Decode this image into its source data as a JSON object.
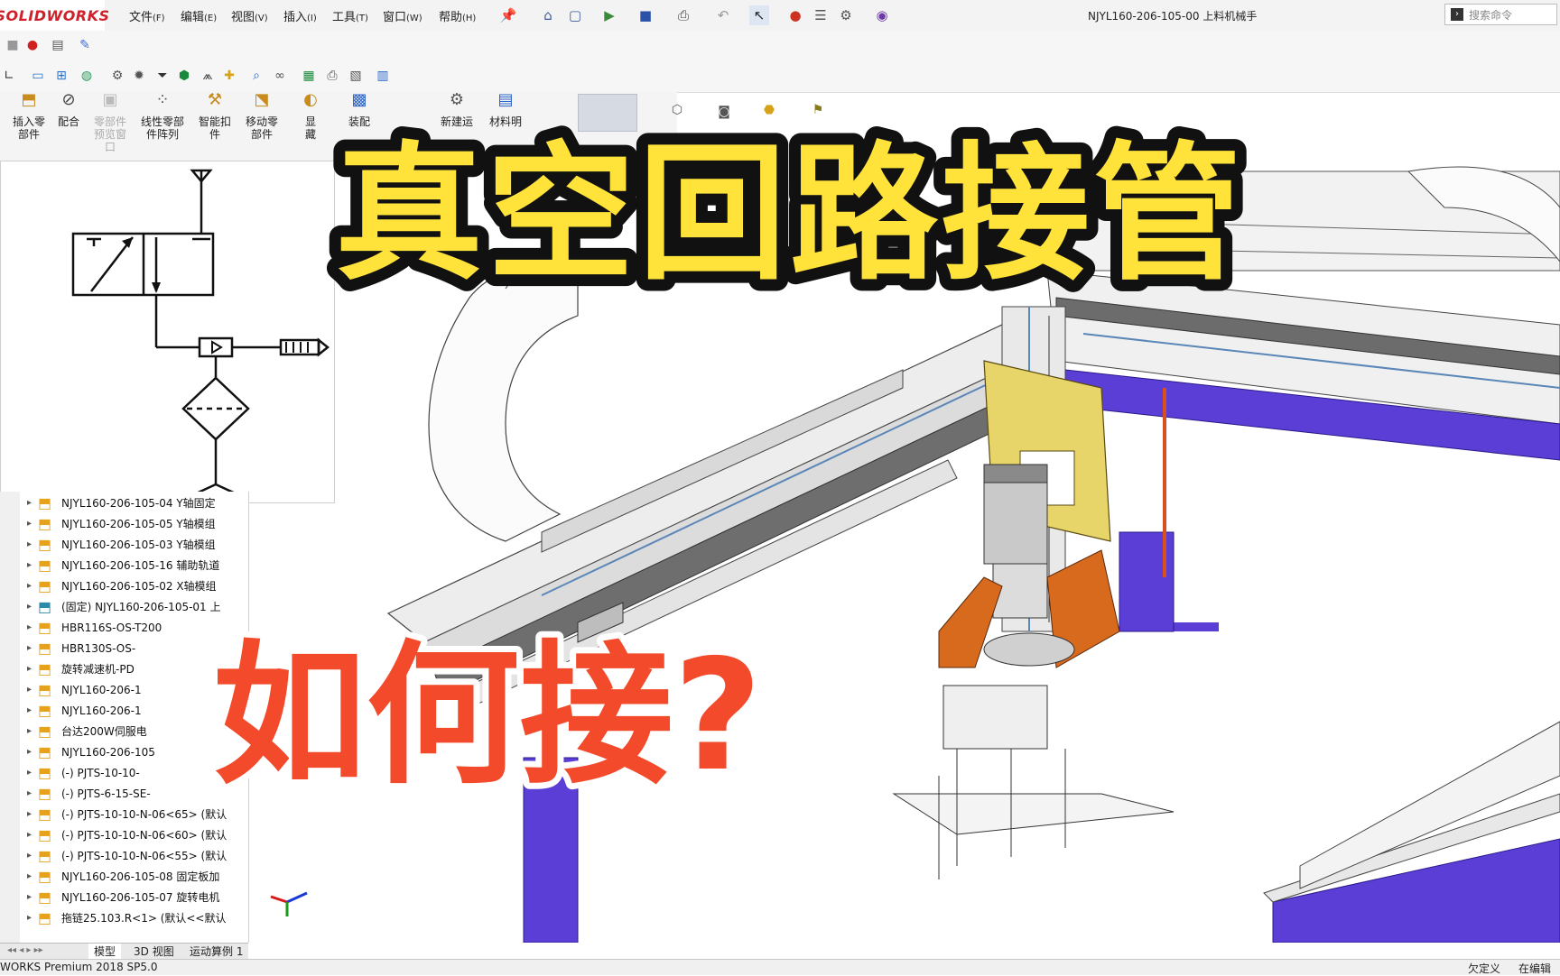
{
  "app": {
    "logo": "SOLIDWORKS",
    "document_title": "NJYL160-206-105-00 上料机械手",
    "search_placeholder": "搜索命令"
  },
  "menu": [
    {
      "label": "文件",
      "key": "(F)"
    },
    {
      "label": "编辑",
      "key": "(E)"
    },
    {
      "label": "视图",
      "key": "(V)"
    },
    {
      "label": "插入",
      "key": "(I)"
    },
    {
      "label": "工具",
      "key": "(T)"
    },
    {
      "label": "窗口",
      "key": "(W)"
    },
    {
      "label": "帮助",
      "key": "(H)"
    }
  ],
  "commands": [
    {
      "label": "插入零\n部件",
      "icon": "insert-component-icon"
    },
    {
      "label": "配合",
      "icon": "mate-icon"
    },
    {
      "label": "零部件\n预览窗\n口",
      "icon": "preview-window-icon",
      "disabled": true
    },
    {
      "label": "线性零部\n件阵列",
      "icon": "linear-pattern-icon"
    },
    {
      "label": "智能扣\n件",
      "icon": "smart-fastener-icon"
    },
    {
      "label": "移动零\n部件",
      "icon": "move-component-icon"
    },
    {
      "label": "显\n藏",
      "icon": "show-hide-icon"
    },
    {
      "label": "装配",
      "icon": "assembly-icon"
    },
    {
      "label": "新建运",
      "icon": "new-motion-icon"
    },
    {
      "label": "材料明",
      "icon": "bom-icon"
    }
  ],
  "tree": [
    "NJYL160-206-105-04   Y轴固定",
    "NJYL160-206-105-05   Y轴模组",
    "NJYL160-206-105-03   Y轴模组",
    "NJYL160-206-105-16   辅助轨道",
    "NJYL160-206-105-02   X轴模组",
    "(固定) NJYL160-206-105-01   上",
    "HBR116S-OS-T200",
    "HBR130S-OS-",
    "旋转减速机-PD",
    "NJYL160-206-1",
    "NJYL160-206-1",
    "台达200W伺服电",
    "NJYL160-206-105",
    "(-) PJTS-10-10-",
    "(-) PJTS-6-15-SE-",
    "(-) PJTS-10-10-N-06<65> (默认",
    "(-) PJTS-10-10-N-06<60> (默认",
    "(-) PJTS-10-10-N-06<55> (默认",
    "NJYL160-206-105-08   固定板加",
    "NJYL160-206-105-07   旋转电机",
    "拖链25.103.R<1> (默认<<默认"
  ],
  "bottom_tabs": [
    "模型",
    "3D 视图",
    "运动算例 1"
  ],
  "status": {
    "left": "WORKS Premium 2018 SP5.0",
    "right1": "欠定义",
    "right2": "在编辑"
  },
  "overlay": {
    "headline": "真空回路接管",
    "subline": "如何接?",
    "headline_color": "#ffe23a",
    "subline_color": "#f24a2a"
  },
  "colors": {
    "frame_blue": "#5b3ed6",
    "plate_yellow": "#e7d56a",
    "bracket_orange": "#d86a1e"
  }
}
